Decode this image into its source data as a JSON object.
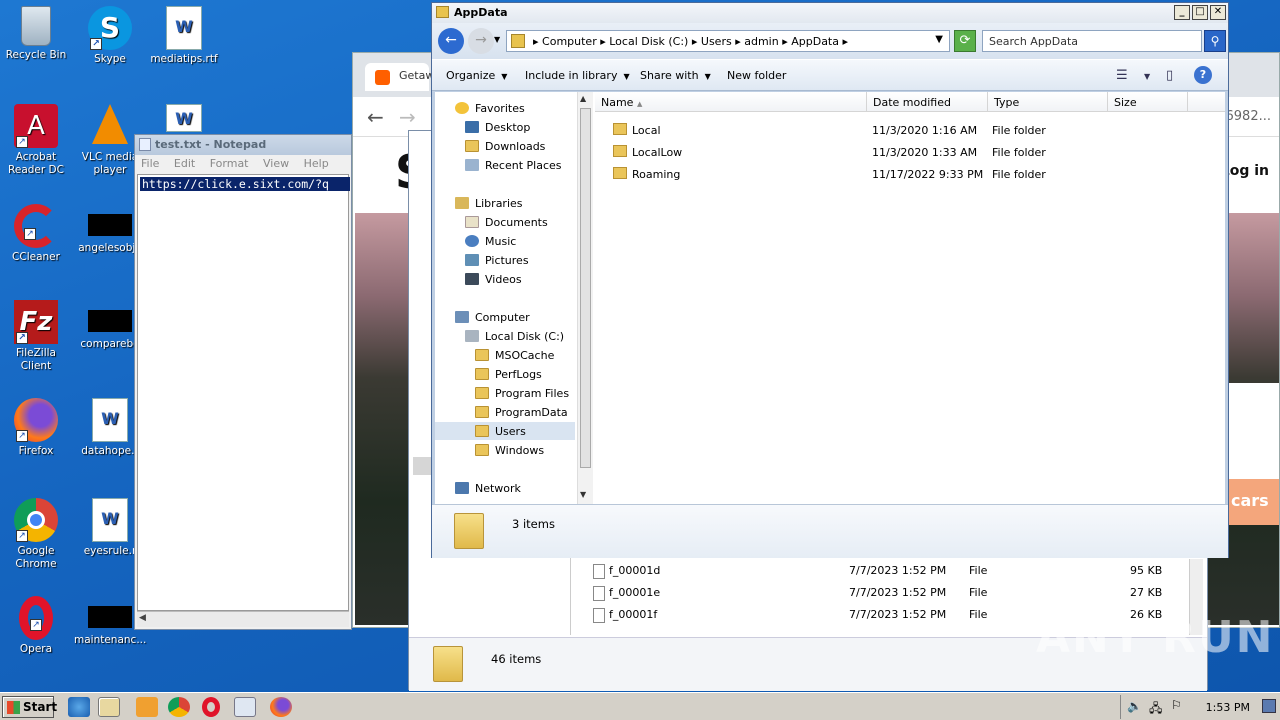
{
  "desktop": {
    "icons": [
      {
        "label": "Recycle Bin"
      },
      {
        "label": "Skype"
      },
      {
        "label": "mediatips.rtf"
      },
      {
        "label": "Acrobat Reader DC"
      },
      {
        "label": "VLC media player"
      },
      {
        "label": "CCleaner"
      },
      {
        "label": "angelesobje"
      },
      {
        "label": "FileZilla Client"
      },
      {
        "label": "comparebo"
      },
      {
        "label": "Firefox"
      },
      {
        "label": "datahope.r"
      },
      {
        "label": "Google Chrome"
      },
      {
        "label": "eyesrule.r"
      },
      {
        "label": "Opera"
      },
      {
        "label": "maintenanc..."
      }
    ]
  },
  "browser": {
    "tab_title": "Getaw",
    "url_tail": "6982...",
    "login_label": "Log in",
    "cars_button": "cars",
    "logo_letter": "S"
  },
  "notepad": {
    "title": "test.txt - Notepad",
    "menu": [
      "File",
      "Edit",
      "Format",
      "View",
      "Help"
    ],
    "content": "https://click.e.sixt.com/?q"
  },
  "explorer_back": {
    "files": [
      {
        "name": "f_00001d",
        "date": "7/7/2023 1:52 PM",
        "type": "File",
        "size": "95 KB"
      },
      {
        "name": "f_00001e",
        "date": "7/7/2023 1:52 PM",
        "type": "File",
        "size": "27 KB"
      },
      {
        "name": "f_00001f",
        "date": "7/7/2023 1:52 PM",
        "type": "File",
        "size": "26 KB"
      }
    ],
    "status": "46 items"
  },
  "explorer": {
    "title": "AppData",
    "breadcrumb": [
      "Computer",
      "Local Disk (C:)",
      "Users",
      "admin",
      "AppData"
    ],
    "search_placeholder": "Search AppData",
    "toolbar": {
      "organize": "Organize",
      "include": "Include in library",
      "share": "Share with",
      "new_folder": "New folder"
    },
    "nav": {
      "favorites": "Favorites",
      "desktop": "Desktop",
      "downloads": "Downloads",
      "recent": "Recent Places",
      "libraries": "Libraries",
      "documents": "Documents",
      "music": "Music",
      "pictures": "Pictures",
      "videos": "Videos",
      "computer": "Computer",
      "local_disk": "Local Disk (C:)",
      "msocache": "MSOCache",
      "perflogs": "PerfLogs",
      "program_files": "Program Files",
      "programdata": "ProgramData",
      "users": "Users",
      "windows": "Windows",
      "network": "Network"
    },
    "columns": {
      "name": "Name",
      "date": "Date modified",
      "type": "Type",
      "size": "Size"
    },
    "files": [
      {
        "name": "Local",
        "date": "11/3/2020 1:16 AM",
        "type": "File folder"
      },
      {
        "name": "LocalLow",
        "date": "11/3/2020 1:33 AM",
        "type": "File folder"
      },
      {
        "name": "Roaming",
        "date": "11/17/2022 9:33 PM",
        "type": "File folder"
      }
    ],
    "status": "3 items"
  },
  "taskbar": {
    "start": "Start",
    "clock": "1:53 PM"
  },
  "watermark": "ANY RUN"
}
